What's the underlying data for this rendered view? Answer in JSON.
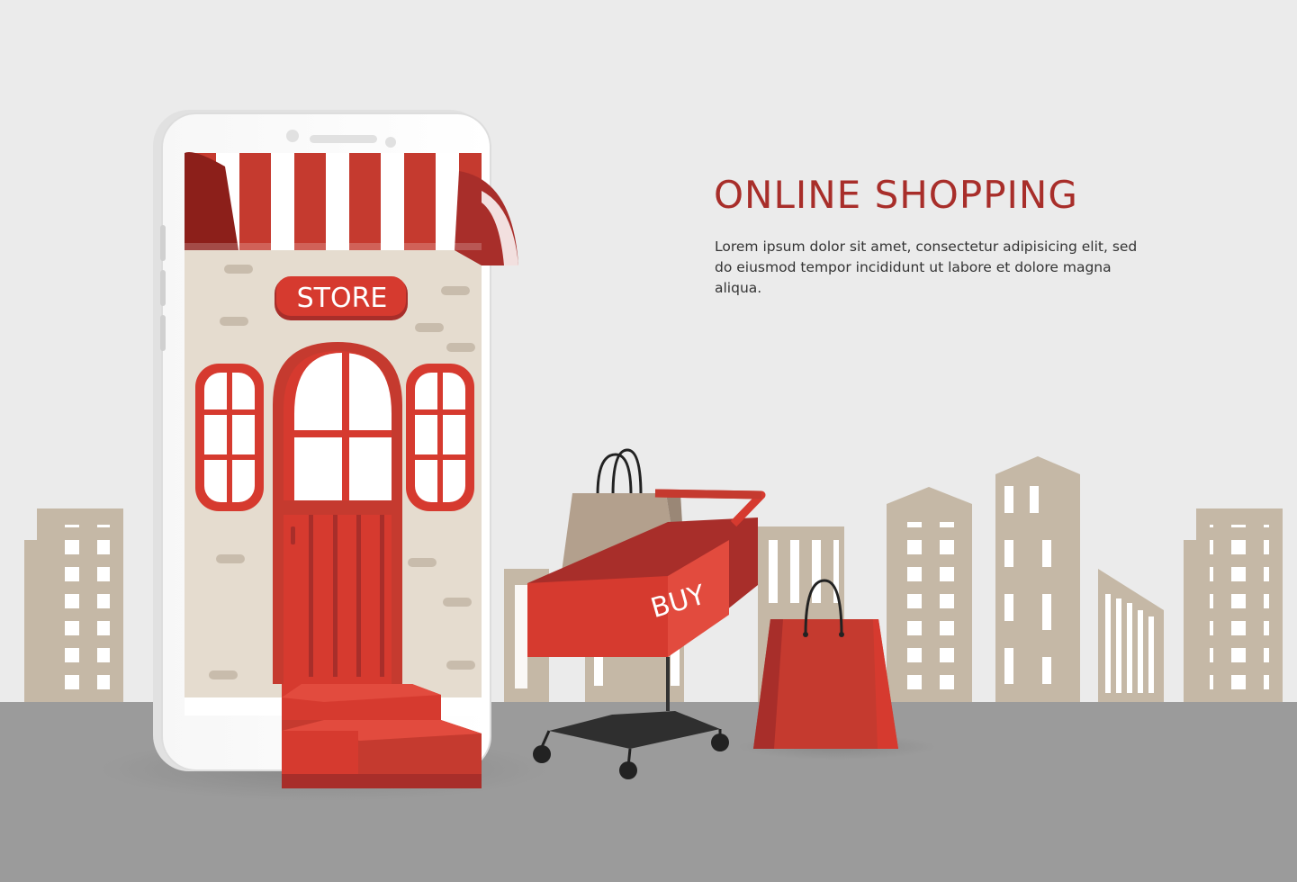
{
  "headline": "ONLINE SHOPPING",
  "body_text": "Lorem ipsum dolor sit amet, consectetur adipisicing elit, sed do eiusmod tempor incididunt ut labore et dolore magna aliqua.",
  "store_sign": "STORE",
  "cart_label": "BUY",
  "colors": {
    "background": "#ebebeb",
    "ground": "#9b9b9b",
    "buildings": "#c5b8a6",
    "accent_red": "#d63a2f",
    "dark_red": "#a82e2a",
    "wall": "#e5dccf"
  }
}
